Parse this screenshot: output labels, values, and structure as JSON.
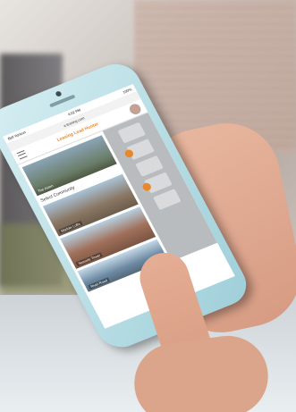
{
  "status": {
    "left": "Bell Verizon",
    "time": "4:02 PM",
    "right": "100%"
  },
  "url": "a leasing.com",
  "app": {
    "brand": "Leasing Lead Hunter"
  },
  "banner": {
    "label": "The Aston"
  },
  "section_title": "Select Community",
  "cards": [
    {
      "label": "Marlow Lofts"
    },
    {
      "label": "Seaside Tower"
    },
    {
      "label": "Rivet Road"
    }
  ],
  "colors": {
    "accent": "#e8882c",
    "phone": "#bfe4ea"
  }
}
